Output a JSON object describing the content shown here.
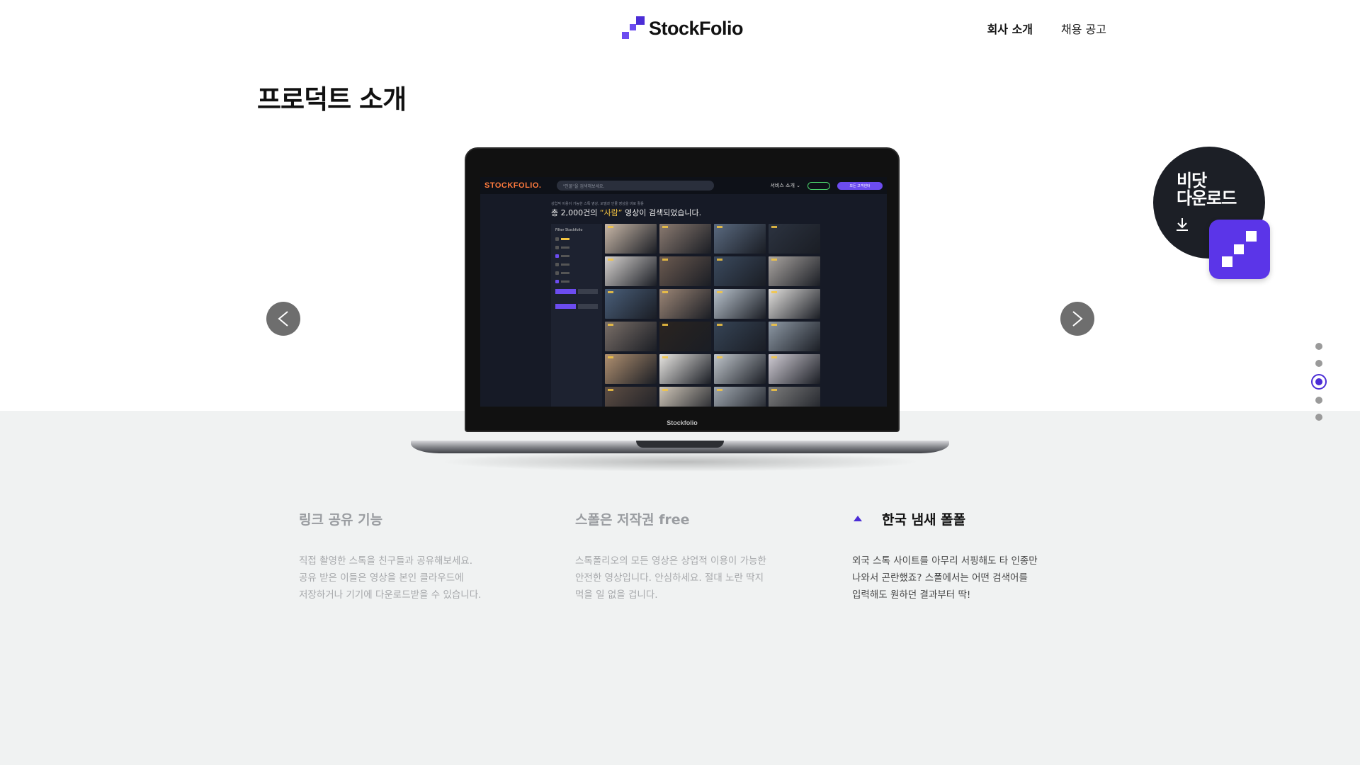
{
  "header": {
    "logo_text": "StockFolio",
    "nav": [
      {
        "label": "회사 소개",
        "active": true
      },
      {
        "label": "채용 공고",
        "active": false
      }
    ]
  },
  "page": {
    "title": "프로덕트 소개"
  },
  "laptop": {
    "brand": "Stockfolio",
    "app": {
      "logo": "STOCKFOLIO.",
      "search_placeholder": "\"인물\"을 검색해보세요.",
      "menu": "서비스 소개 ⌄",
      "cta": "모든 고객센터",
      "subtitle": "상업적 이용이 가능한 스톡 영상, 모델과 인물 영상을 바로 활용",
      "headline_prefix": "총 2,000건의 ",
      "headline_keyword": "“사람”",
      "headline_suffix": " 영상이 검색되었습니다.",
      "filter_title": "Filter Stockfolio"
    }
  },
  "carousel": {
    "prev_icon": "chevron-left-icon",
    "next_icon": "chevron-right-icon",
    "dots": [
      false,
      false,
      true,
      false,
      false
    ]
  },
  "download_badge": {
    "line1": "비닷",
    "line2": "다운로드",
    "icon": "download-icon",
    "color": "#5b35e8"
  },
  "features": [
    {
      "title": "링크 공유 기능",
      "description": "직접 촬영한 스톡을 친구들과 공유해보세요.\n공유 받은 이들은 영상을 본인 클라우드에\n저장하거나 기기에 다운로드받을 수 있습니다.",
      "active": false
    },
    {
      "title": "스폴은 저작권 free",
      "description": "스톡폴리오의 모든 영상은 상업적 이용이 가능한\n안전한 영상입니다. 안심하세요. 절대 노란 딱지\n먹을 일 없을 겁니다.",
      "active": false
    },
    {
      "title": "한국 냄새 폴폴",
      "description": "외국 스톡 사이트를 아무리 서핑해도 타 인종만\n나와서 곤란했죠? 스폴에서는 어떤 검색어를\n입력해도 원하던 결과부터 딱!",
      "active": true
    }
  ],
  "colors": {
    "accent": "#4b2dd6",
    "band": "#f0f2f2"
  }
}
